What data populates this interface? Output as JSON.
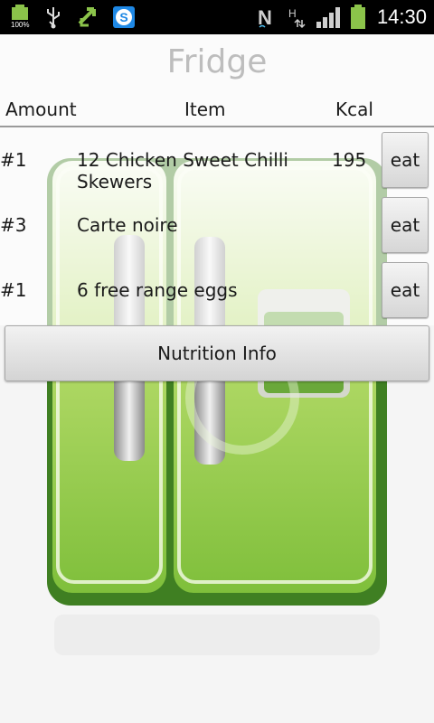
{
  "status_bar": {
    "battery_percent": "100%",
    "time": "14:30",
    "left_icons": [
      "battery-icon",
      "usb-icon",
      "sync-arrows-icon",
      "skype-icon"
    ],
    "right_icons": [
      "nfc-icon",
      "hspa-data-icon",
      "signal-icon",
      "battery-icon"
    ]
  },
  "app": {
    "title": "Fridge",
    "columns": {
      "amount": "Amount",
      "item": "Item",
      "kcal": "Kcal"
    },
    "rows": [
      {
        "amount": "#1",
        "item": "12 Chicken Sweet Chilli Skewers",
        "kcal": "195",
        "action": "eat"
      },
      {
        "amount": "#3",
        "item": "Carte noire",
        "kcal": "",
        "action": "eat"
      },
      {
        "amount": "#1",
        "item": "6 free range eggs",
        "kcal": "",
        "action": "eat"
      }
    ],
    "nutrition_button": "Nutrition Info"
  },
  "colors": {
    "status_bar_bg": "#000000",
    "title_text": "#bdbdbd",
    "fridge_green": "#7cb342",
    "battery_green": "#8bc34a"
  }
}
